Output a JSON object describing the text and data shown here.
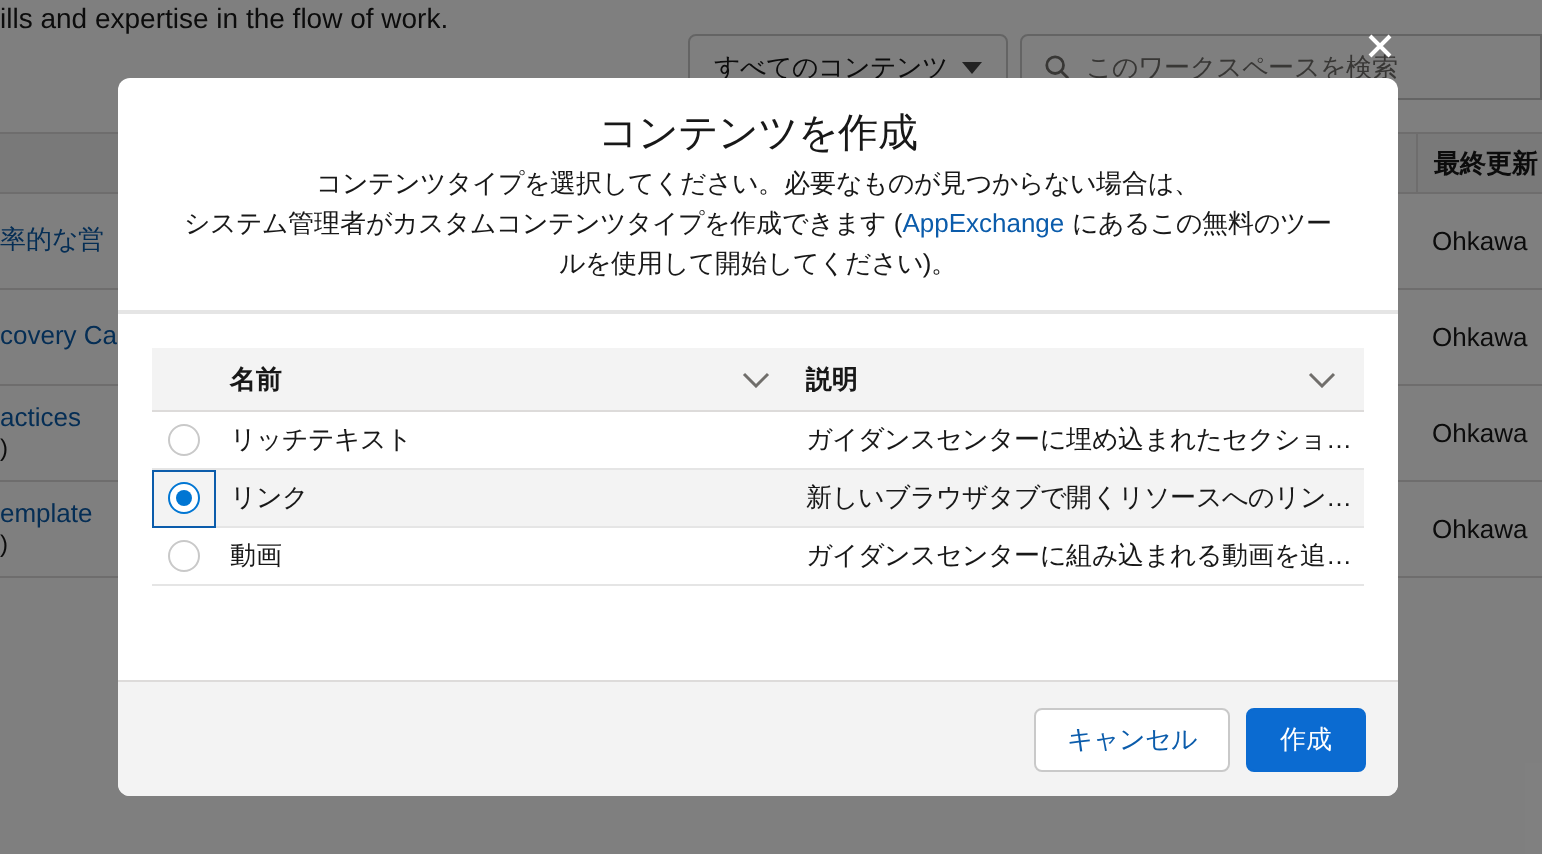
{
  "background": {
    "intro_text": "ills and expertise in the flow of work.",
    "filter_dropdown": {
      "value": "すべてのコンテンツ"
    },
    "search": {
      "placeholder": "このワークスペースを検索"
    },
    "table": {
      "column_header": "最終更新",
      "rows": [
        {
          "name": "率的な営",
          "owner": "Ohkawa"
        },
        {
          "name": "covery Ca",
          "owner": "Ohkawa"
        },
        {
          "name": "actices",
          "sub": ")",
          "owner": "Ohkawa"
        },
        {
          "name": "emplate",
          "sub": ")",
          "owner": "Ohkawa"
        }
      ]
    }
  },
  "modal": {
    "title": "コンテンツを作成",
    "description": {
      "line_1": "コンテンツタイプを選択してください。必要なものが見つからない場合は、",
      "before_link": "システム管理者がカスタムコンテンツタイプを作成できます (",
      "link": "AppExchange",
      "after_link": " にあるこの無料のツールを使用して開始してください)。"
    },
    "table": {
      "columns": [
        {
          "label": "名前"
        },
        {
          "label": "説明"
        }
      ],
      "rows": [
        {
          "name": "リッチテキスト",
          "description": "ガイダンスセンターに埋め込まれたセクショ…",
          "selected": false
        },
        {
          "name": "リンク",
          "description": "新しいブラウザタブで開くリソースへのリン…",
          "selected": true
        },
        {
          "name": "動画",
          "description": "ガイダンスセンターに組み込まれる動画を追…",
          "selected": false
        }
      ]
    },
    "buttons": [
      {
        "label": "キャンセル",
        "kind": "neutral"
      },
      {
        "label": "作成",
        "kind": "brand"
      }
    ]
  }
}
